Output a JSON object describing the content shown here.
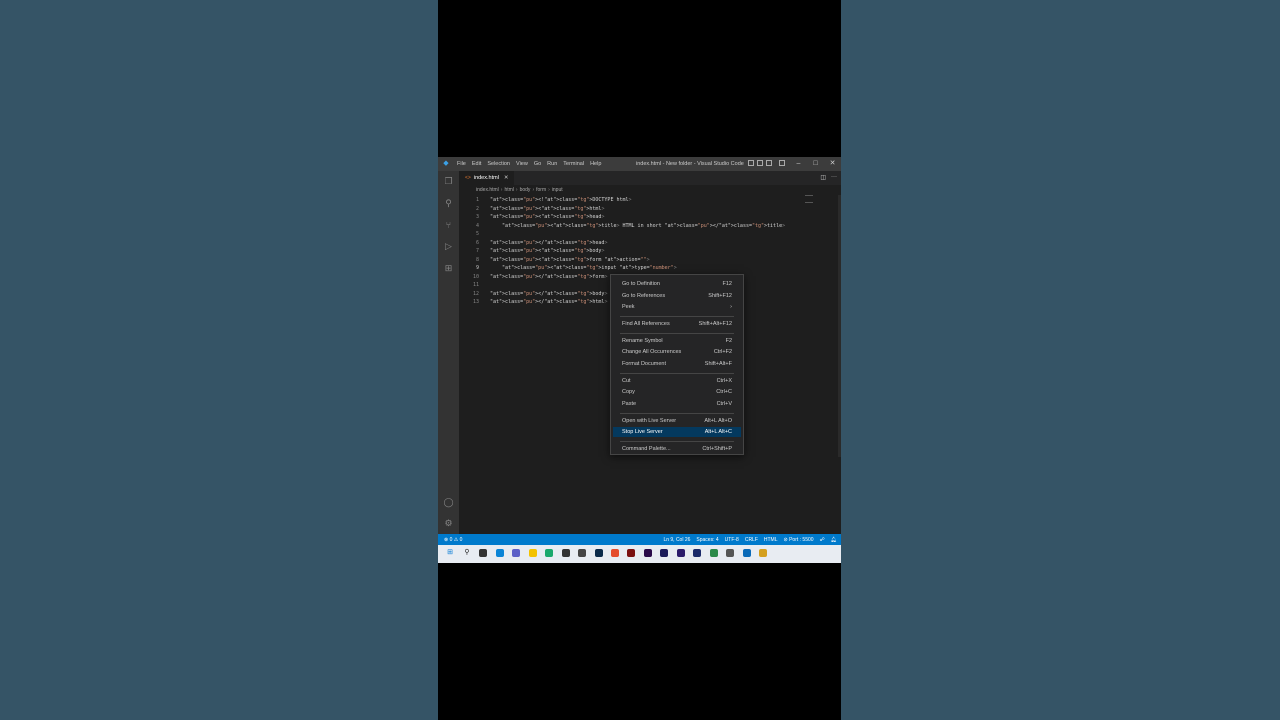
{
  "app": {
    "menu": [
      "File",
      "Edit",
      "Selection",
      "View",
      "Go",
      "Run",
      "Terminal",
      "Help"
    ],
    "window_title": "index.html - New folder - Visual Studio Code"
  },
  "tab": {
    "label": "index.html",
    "close": "✕"
  },
  "breadcrumb": [
    "index.html",
    "html",
    "body",
    "form",
    "input"
  ],
  "editor": {
    "line_numbers": [
      "1",
      "2",
      "3",
      "4",
      "5",
      "6",
      "7",
      "8",
      "9",
      "10",
      "11",
      "12",
      "13"
    ],
    "current_line": "9",
    "lines": [
      "<!DOCTYPE html>",
      "<html>",
      "<head>",
      "    <title> HTML in short </title>",
      "",
      "</head>",
      "<body>",
      "<form action=\"\">",
      "    <input type=\"number\">",
      "</form>",
      "",
      "</body>",
      "</html>"
    ]
  },
  "context_menu": {
    "items": [
      {
        "label": "Go to Definition",
        "shortcut": "F12"
      },
      {
        "label": "Go to References",
        "shortcut": "Shift+F12"
      },
      {
        "label": "Peek",
        "shortcut": "›"
      },
      {
        "label": "Find All References",
        "shortcut": "Shift+Alt+F12"
      },
      {
        "label": "Rename Symbol",
        "shortcut": "F2"
      },
      {
        "label": "Change All Occurrences",
        "shortcut": "Ctrl+F2"
      },
      {
        "label": "Format Document",
        "shortcut": "Shift+Alt+F"
      },
      {
        "label": "Cut",
        "shortcut": "Ctrl+X"
      },
      {
        "label": "Copy",
        "shortcut": "Ctrl+C"
      },
      {
        "label": "Paste",
        "shortcut": "Ctrl+V"
      },
      {
        "label": "Open with Live Server",
        "shortcut": "Alt+L Alt+O"
      },
      {
        "label": "Stop Live Server",
        "shortcut": "Alt+L Alt+C"
      },
      {
        "label": "Command Palette...",
        "shortcut": "Ctrl+Shift+P"
      }
    ],
    "highlighted": "Stop Live Server"
  },
  "status": {
    "problems": "⊗ 0 ⚠ 0",
    "position": "Ln 9, Col 26",
    "spaces": "Spaces: 4",
    "encoding": "UTF-8",
    "eol": "CRLF",
    "language": "HTML",
    "port": "⊘ Port : 5500"
  },
  "colors": {
    "statusbar": "#007acc",
    "highlight": "#04395e",
    "background": "#355466"
  }
}
